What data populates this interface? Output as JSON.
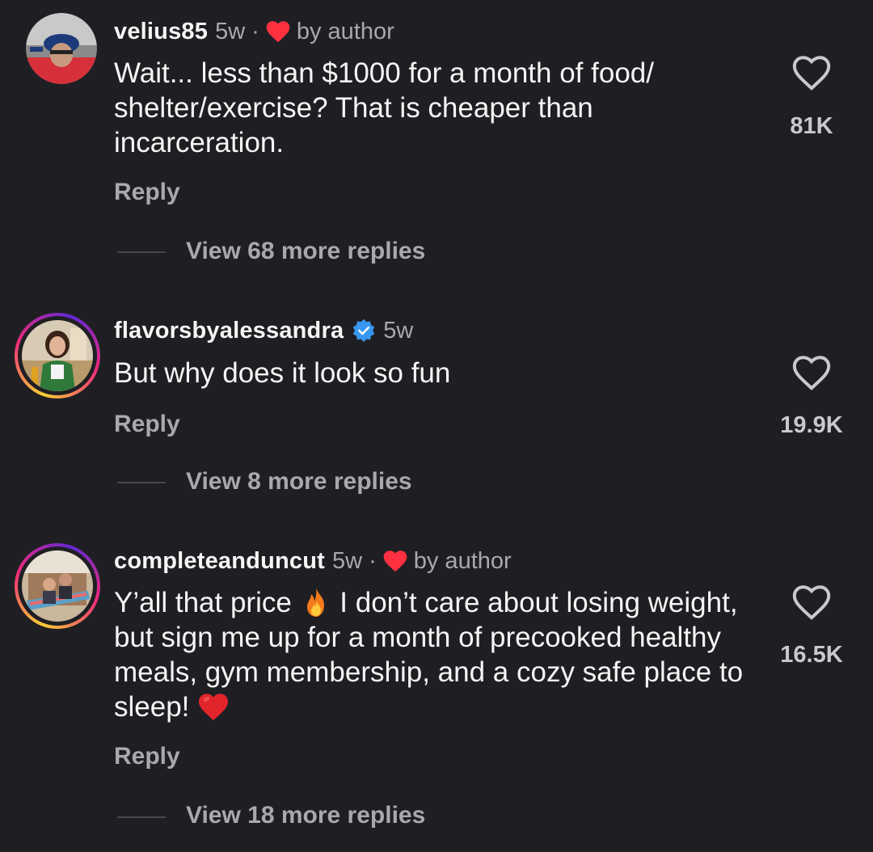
{
  "comments": [
    {
      "username": "velius85",
      "time": "5w",
      "separator": "·",
      "author_badge": "by author",
      "text": "Wait... less than $1000 for a month of food/ shelter/exercise? That is cheaper than incarceration.",
      "reply_label": "Reply",
      "view_replies": "View 68 more replies",
      "likes": "81K"
    },
    {
      "username": "flavorsbyalessandra",
      "verified": true,
      "time": "5w",
      "text": "But why does it look so fun",
      "reply_label": "Reply",
      "view_replies": "View 8 more replies",
      "likes": "19.9K"
    },
    {
      "username": "completeanduncut",
      "time": "5w",
      "separator": "·",
      "author_badge": "by author",
      "text_part1": "Y’all that price",
      "emoji_1": "fire-emoji",
      "text_part2": "I don’t care about losing weight, but sign me up for a month of precooked healthy meals, gym membership, and a cozy safe place to sleep!",
      "emoji_2": "red-heart-emoji",
      "reply_label": "Reply",
      "view_replies": "View 18 more replies",
      "likes": "16.5K"
    }
  ],
  "colors": {
    "background": "#1f1f23",
    "primary_text": "#f5f5f5",
    "secondary_text": "#a8a8ad",
    "author_heart": "#ff3040",
    "verified_blue": "#3897f0"
  },
  "icons": {
    "like": "heart-outline-icon",
    "author_liked": "heart-filled-icon",
    "verified": "verified-badge-icon"
  }
}
